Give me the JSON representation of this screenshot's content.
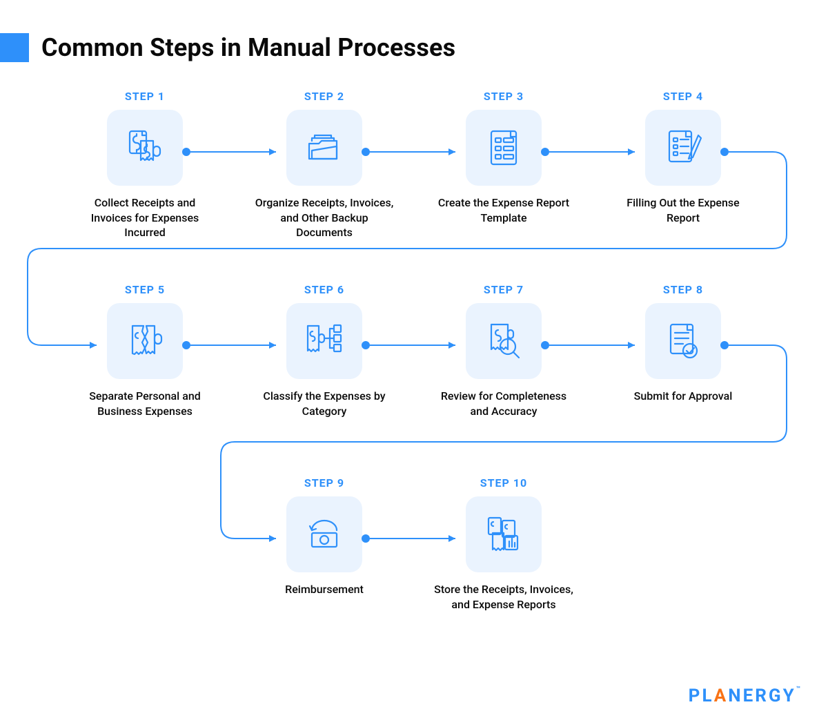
{
  "title": "Common Steps in Manual Processes",
  "brand": {
    "name": "PLANERGY",
    "tm": "™"
  },
  "colors": {
    "accent": "#2E90FA",
    "icon_bg": "#EAF3FE",
    "brand_orange": "#F97316"
  },
  "steps": [
    {
      "label": "STEP 1",
      "icon": "receipts-invoices-icon",
      "desc": "Collect Receipts and Invoices for Expenses Incurred"
    },
    {
      "label": "STEP 2",
      "icon": "folder-documents-icon",
      "desc": "Organize Receipts, Invoices, and Other Backup Documents"
    },
    {
      "label": "STEP 3",
      "icon": "report-template-icon",
      "desc": "Create the Expense Report Template"
    },
    {
      "label": "STEP 4",
      "icon": "fill-form-icon",
      "desc": "Filling Out the Expense Report"
    },
    {
      "label": "STEP 5",
      "icon": "split-receipt-icon",
      "desc": "Separate Personal and Business Expenses"
    },
    {
      "label": "STEP 6",
      "icon": "classify-tree-icon",
      "desc": "Classify the Expenses by Category"
    },
    {
      "label": "STEP 7",
      "icon": "review-magnify-icon",
      "desc": "Review for Completeness and Accuracy"
    },
    {
      "label": "STEP 8",
      "icon": "submit-approval-icon",
      "desc": "Submit for Approval"
    },
    {
      "label": "STEP 9",
      "icon": "reimbursement-icon",
      "desc": "Reimbursement"
    },
    {
      "label": "STEP 10",
      "icon": "store-documents-icon",
      "desc": "Store the Receipts, Invoices, and Expense Reports"
    }
  ],
  "flow": [
    {
      "from": 1,
      "to": 2
    },
    {
      "from": 2,
      "to": 3
    },
    {
      "from": 3,
      "to": 4
    },
    {
      "from": 4,
      "to": 5
    },
    {
      "from": 5,
      "to": 6
    },
    {
      "from": 6,
      "to": 7
    },
    {
      "from": 7,
      "to": 8
    },
    {
      "from": 8,
      "to": 9
    },
    {
      "from": 9,
      "to": 10
    }
  ]
}
